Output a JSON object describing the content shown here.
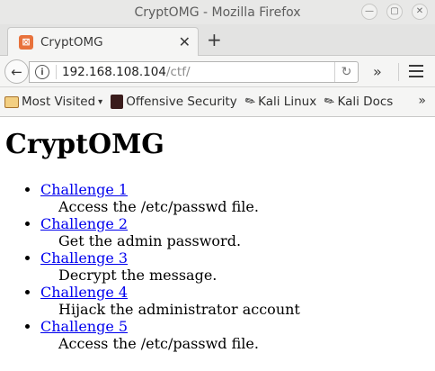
{
  "window": {
    "title": "CryptOMG - Mozilla Firefox",
    "controls": [
      "minimize-icon",
      "maximize-icon",
      "close-icon"
    ]
  },
  "tabs": [
    {
      "title": "CryptOMG",
      "favicon": "xampp-favicon",
      "close": "✕"
    }
  ],
  "newtab": "+",
  "navbar": {
    "url_host": "192.168.108.104",
    "url_path": "/ctf/"
  },
  "bookmarks": [
    {
      "label": "Most Visited",
      "icon": "folder-icon",
      "has_dropdown": true
    },
    {
      "label": "Offensive Security",
      "icon": "offsec-icon"
    },
    {
      "label": "Kali Linux",
      "icon": "kali-dragon-icon"
    },
    {
      "label": "Kali Docs",
      "icon": "kali-dragon-icon"
    }
  ],
  "page": {
    "heading": "CryptOMG",
    "challenges": [
      {
        "link": "Challenge 1",
        "desc": "Access the /etc/passwd file."
      },
      {
        "link": "Challenge 2",
        "desc": "Get the admin password."
      },
      {
        "link": "Challenge 3",
        "desc": "Decrypt the message."
      },
      {
        "link": "Challenge 4",
        "desc": "Hijack the administrator account"
      },
      {
        "link": "Challenge 5",
        "desc": "Access the /etc/passwd file."
      }
    ]
  },
  "colors": {
    "link": "#0000ee",
    "chrome": "#f5f5f4",
    "titlebar": "#e8e8e7"
  }
}
